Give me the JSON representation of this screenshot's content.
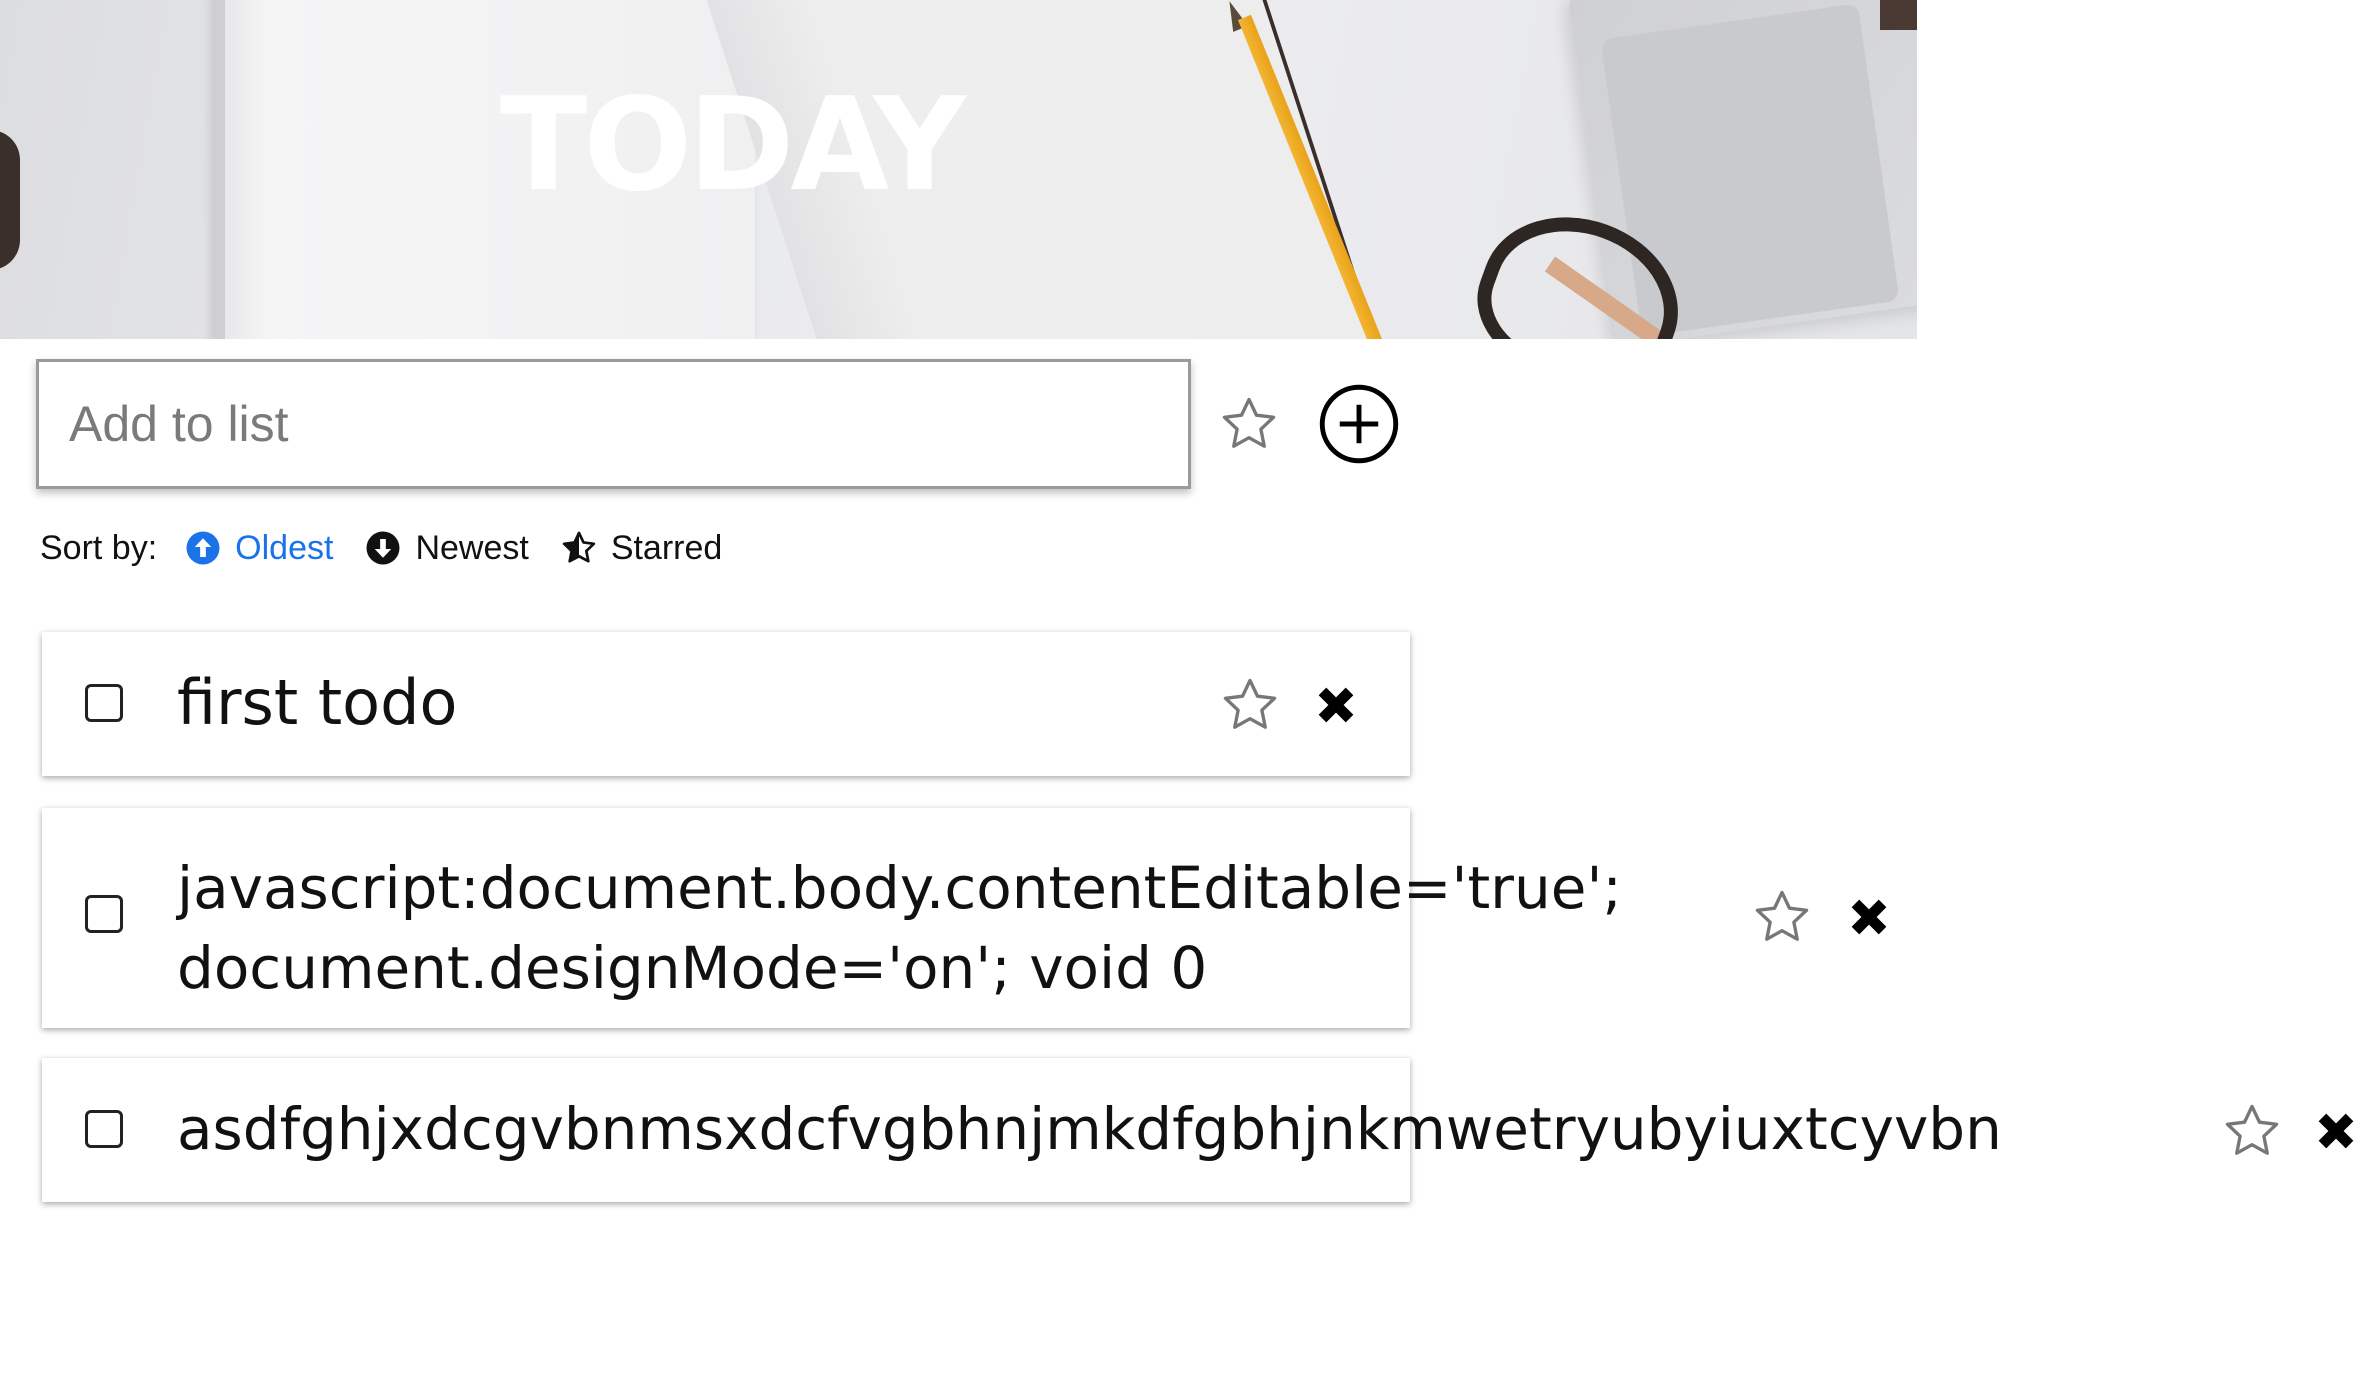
{
  "header": {
    "title": "TODAY"
  },
  "add_bar": {
    "placeholder": "Add to list",
    "value": ""
  },
  "sort": {
    "label": "Sort by:",
    "options": [
      {
        "label": "Oldest",
        "icon": "arrow-up-circle-icon",
        "active": true
      },
      {
        "label": "Newest",
        "icon": "arrow-down-circle-icon",
        "active": false
      },
      {
        "label": "Starred",
        "icon": "star-half-icon",
        "active": false
      }
    ],
    "active_color": "#1a73e8"
  },
  "todos": [
    {
      "lines": [
        "first todo"
      ],
      "done": false,
      "starred": false
    },
    {
      "lines": [
        "javascript:document.body.contentEditable='true';",
        "document.designMode='on'; void 0"
      ],
      "done": false,
      "starred": false
    },
    {
      "lines": [
        "asdfghjxdcgvbnmsxdcfvgbhnjmkdfgbhjnkmwetryubyiuxtcyvbn"
      ],
      "done": false,
      "starred": false
    }
  ]
}
